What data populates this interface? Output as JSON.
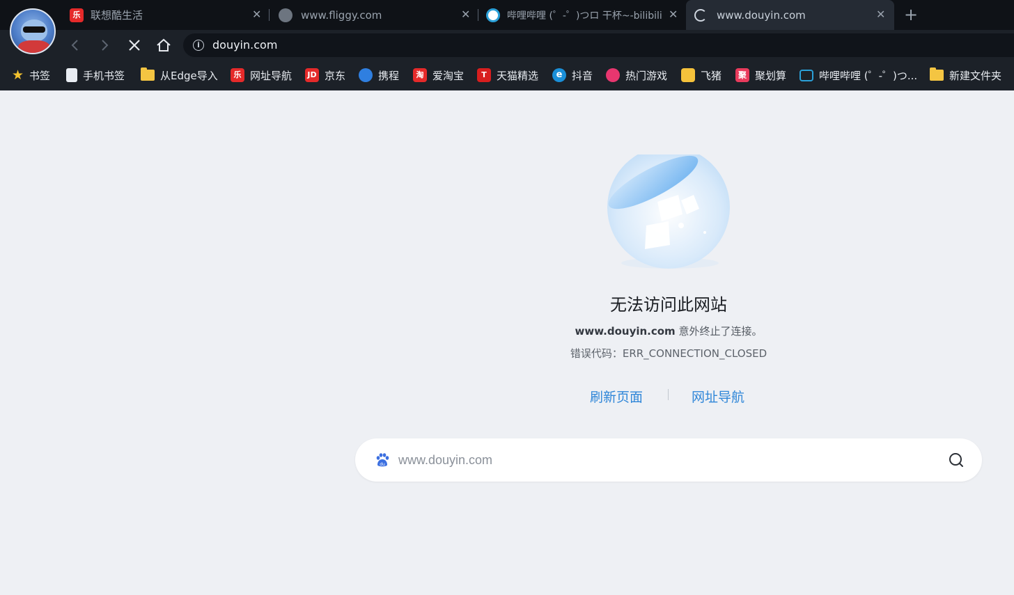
{
  "tabs": [
    {
      "title": "联想酷生活",
      "favicon": "lenovo-icon",
      "active": false
    },
    {
      "title": "www.fliggy.com",
      "favicon": "globe-icon",
      "active": false
    },
    {
      "title": "哔哩哔哩 (゜-゜)つロ 干杯~-bilibili",
      "favicon": "bilibili-icon",
      "active": false
    },
    {
      "title": "www.douyin.com",
      "favicon": "loading-spinner-icon",
      "active": true
    }
  ],
  "toolbar": {
    "url": "douyin.com"
  },
  "bookmarks": [
    {
      "label": "书签",
      "icon": "star-icon"
    },
    {
      "label": "手机书签",
      "icon": "phone-bookmark-icon"
    },
    {
      "label": "从Edge导入",
      "icon": "folder-icon"
    },
    {
      "label": "网址导航",
      "icon": "lenovo-icon"
    },
    {
      "label": "京东",
      "icon": "jd-icon",
      "icon_text": "JD"
    },
    {
      "label": "携程",
      "icon": "ctrip-icon"
    },
    {
      "label": "爱淘宝",
      "icon": "taobao-icon",
      "icon_text": "淘"
    },
    {
      "label": "天猫精选",
      "icon": "tmall-icon",
      "icon_text": "T"
    },
    {
      "label": "抖音",
      "icon": "edge-icon",
      "icon_text": "e"
    },
    {
      "label": "热门游戏",
      "icon": "game-icon"
    },
    {
      "label": "飞猪",
      "icon": "fliggy-icon"
    },
    {
      "label": "聚划算",
      "icon": "juhuasuan-icon",
      "icon_text": "聚"
    },
    {
      "label": "哔哩哔哩 (゜-゜)つ...",
      "icon": "bilibili-icon"
    },
    {
      "label": "新建文件夹",
      "icon": "folder-icon"
    }
  ],
  "error": {
    "title": "无法访问此网站",
    "host": "www.douyin.com",
    "message": " 意外终止了连接。",
    "code": "错误代码：ERR_CONNECTION_CLOSED",
    "refresh_label": "刷新页面",
    "nav_label": "网址导航"
  },
  "search": {
    "placeholder": "www.douyin.com",
    "engine_icon": "baidu-icon"
  },
  "colors": {
    "page_bg": "#eef0f4",
    "chrome_bg": "#1c2128",
    "link": "#2f86d8"
  }
}
